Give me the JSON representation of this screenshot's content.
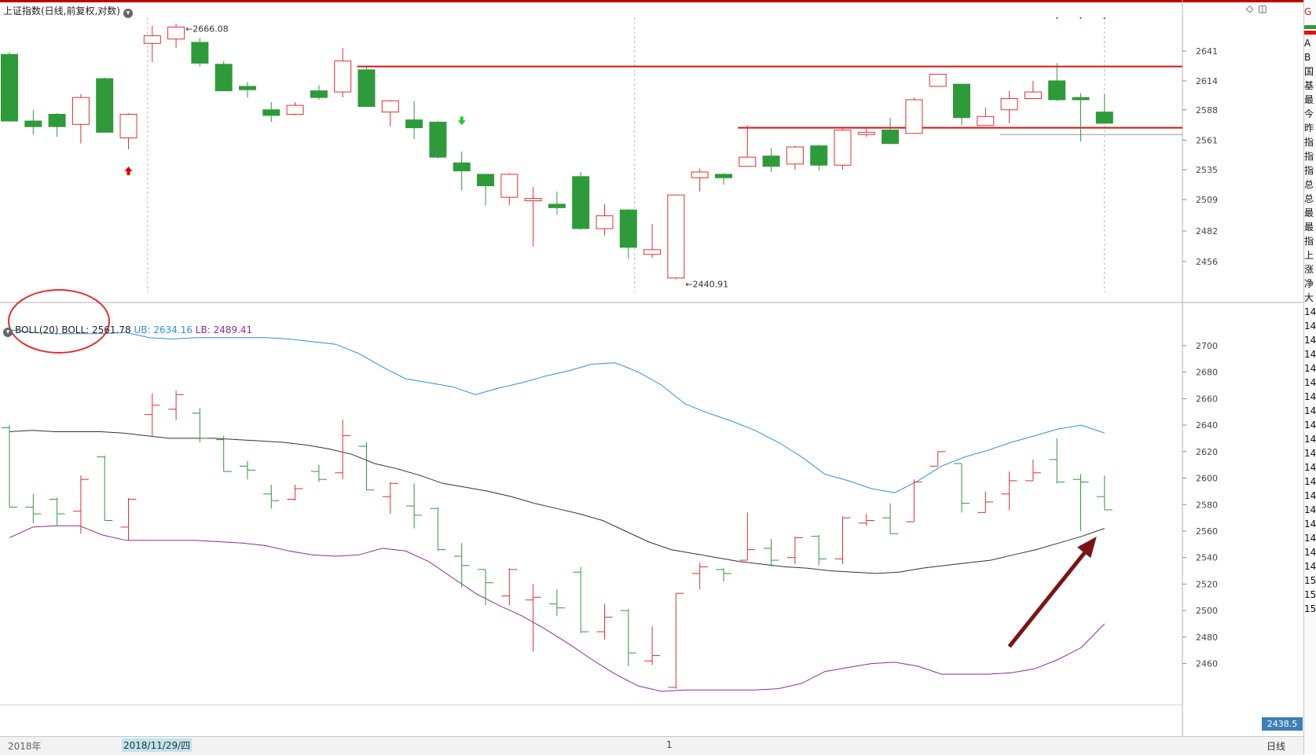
{
  "header": {
    "title": "上证指数(日线,前复权,对数)",
    "toggle_icon": "chevron-down-icon",
    "icons": [
      "diamond-icon",
      "window-icon"
    ]
  },
  "colors": {
    "up": "#e03030",
    "down": "#2f9a3a",
    "line_red": "#e01010",
    "ub": "#2f8fd8",
    "mid": "#333333",
    "lb": "#8a2d9a",
    "arrow": "#7a1515"
  },
  "right_strip": {
    "head": "G",
    "items": [
      "A",
      "B",
      "国",
      "基",
      "最",
      "今",
      "昨",
      "指",
      "指",
      "指",
      "总",
      "总",
      "最",
      "最",
      "指",
      "上",
      "涨",
      "净",
      "大",
      "14",
      "14",
      "14",
      "14",
      "14",
      "14",
      "14",
      "14",
      "14",
      "14",
      "14",
      "14",
      "14",
      "14",
      "14",
      "14",
      "14",
      "14",
      "14",
      "15",
      "15",
      "15"
    ]
  },
  "boll": {
    "toggle_icon": "chevron-down-icon",
    "name": "BOLL(20)",
    "boll_label": "BOLL: 2561.78",
    "ub_label": "UB: 2634.16",
    "lb_label": "LB: 2489.41",
    "cursor_value": "2438.5"
  },
  "bottom_bar": {
    "year": "2018年",
    "cursor_date": "2018/11/29/四",
    "marker_one": "1",
    "period": "日线"
  },
  "chart_data": [
    {
      "type": "candlestick",
      "scale": "log",
      "ylim": [
        2430,
        2672
      ],
      "yticks": [
        2456,
        2482,
        2509,
        2535,
        2561,
        2588,
        2614,
        2641
      ],
      "annotations": {
        "high_label": "2666.08",
        "low_label": "2440.91"
      },
      "hlines": [
        {
          "value": 2627,
          "from": 15,
          "to": 47
        },
        {
          "value": 2572,
          "from": 31,
          "to": 47
        },
        {
          "value": 2566,
          "from": 42,
          "to": 47,
          "color": "gray"
        }
      ],
      "signals": [
        {
          "candle": 5,
          "kind": "up",
          "price": 2553
        },
        {
          "candle": 19,
          "kind": "down",
          "price": 2566
        }
      ],
      "candles": [
        {
          "o": 2638,
          "h": 2640,
          "l": 2578,
          "c": 2578
        },
        {
          "o": 2578,
          "h": 2588,
          "l": 2566,
          "c": 2573
        },
        {
          "o": 2584,
          "h": 2585,
          "l": 2564,
          "c": 2573
        },
        {
          "o": 2575,
          "h": 2602,
          "l": 2558,
          "c": 2599
        },
        {
          "o": 2616,
          "h": 2617,
          "l": 2568,
          "c": 2568
        },
        {
          "o": 2563,
          "h": 2585,
          "l": 2553,
          "c": 2584
        },
        {
          "o": 2648,
          "h": 2664,
          "l": 2631,
          "c": 2655
        },
        {
          "o": 2652,
          "h": 2666,
          "l": 2644,
          "c": 2663
        },
        {
          "o": 2649,
          "h": 2653,
          "l": 2627,
          "c": 2630
        },
        {
          "o": 2629,
          "h": 2632,
          "l": 2605,
          "c": 2605
        },
        {
          "o": 2609,
          "h": 2613,
          "l": 2599,
          "c": 2606
        },
        {
          "o": 2588,
          "h": 2595,
          "l": 2577,
          "c": 2583
        },
        {
          "o": 2584,
          "h": 2595,
          "l": 2583,
          "c": 2592
        },
        {
          "o": 2605,
          "h": 2610,
          "l": 2597,
          "c": 2599
        },
        {
          "o": 2604,
          "h": 2644,
          "l": 2599,
          "c": 2632
        },
        {
          "o": 2624,
          "h": 2627,
          "l": 2591,
          "c": 2591
        },
        {
          "o": 2586,
          "h": 2597,
          "l": 2573,
          "c": 2596
        },
        {
          "o": 2579,
          "h": 2596,
          "l": 2562,
          "c": 2572
        },
        {
          "o": 2577,
          "h": 2578,
          "l": 2545,
          "c": 2546
        },
        {
          "o": 2541,
          "h": 2551,
          "l": 2517,
          "c": 2534
        },
        {
          "o": 2531,
          "h": 2531,
          "l": 2504,
          "c": 2521
        },
        {
          "o": 2511,
          "h": 2532,
          "l": 2504,
          "c": 2531
        },
        {
          "o": 2508,
          "h": 2520,
          "l": 2469,
          "c": 2510
        },
        {
          "o": 2505,
          "h": 2516,
          "l": 2496,
          "c": 2502
        },
        {
          "o": 2529,
          "h": 2533,
          "l": 2483,
          "c": 2484
        },
        {
          "o": 2484,
          "h": 2505,
          "l": 2478,
          "c": 2495
        },
        {
          "o": 2500,
          "h": 2501,
          "l": 2458,
          "c": 2468
        },
        {
          "o": 2462,
          "h": 2488,
          "l": 2459,
          "c": 2466
        },
        {
          "o": 2442,
          "h": 2513,
          "l": 2441,
          "c": 2513
        },
        {
          "o": 2528,
          "h": 2536,
          "l": 2516,
          "c": 2533
        },
        {
          "o": 2531,
          "h": 2532,
          "l": 2522,
          "c": 2528
        },
        {
          "o": 2538,
          "h": 2574,
          "l": 2538,
          "c": 2546
        },
        {
          "o": 2547,
          "h": 2554,
          "l": 2533,
          "c": 2538
        },
        {
          "o": 2540,
          "h": 2556,
          "l": 2535,
          "c": 2555
        },
        {
          "o": 2556,
          "h": 2557,
          "l": 2534,
          "c": 2539
        },
        {
          "o": 2539,
          "h": 2571,
          "l": 2535,
          "c": 2570
        },
        {
          "o": 2566,
          "h": 2573,
          "l": 2564,
          "c": 2568
        },
        {
          "o": 2570,
          "h": 2581,
          "l": 2558,
          "c": 2558
        },
        {
          "o": 2567,
          "h": 2599,
          "l": 2567,
          "c": 2597
        },
        {
          "o": 2609,
          "h": 2620,
          "l": 2609,
          "c": 2620
        },
        {
          "o": 2611,
          "h": 2611,
          "l": 2574,
          "c": 2581
        },
        {
          "o": 2574,
          "h": 2590,
          "l": 2574,
          "c": 2582
        },
        {
          "o": 2588,
          "h": 2605,
          "l": 2576,
          "c": 2598
        },
        {
          "o": 2598,
          "h": 2614,
          "l": 2598,
          "c": 2604
        },
        {
          "o": 2614,
          "h": 2630,
          "l": 2596,
          "c": 2597
        },
        {
          "o": 2599,
          "h": 2603,
          "l": 2560,
          "c": 2597
        },
        {
          "o": 2586,
          "h": 2602,
          "l": 2576,
          "c": 2576
        }
      ]
    },
    {
      "type": "line",
      "title": "BOLL(20)",
      "ylim": [
        2439,
        2713
      ],
      "yticks": [
        2460,
        2480,
        2500,
        2520,
        2540,
        2560,
        2580,
        2600,
        2620,
        2640,
        2660,
        2680,
        2700
      ],
      "series": [
        {
          "name": "UB",
          "values": [
            2712,
            2710,
            2709,
            2709,
            2709,
            2710,
            2706,
            2705,
            2706,
            2706,
            2706,
            2706,
            2705,
            2703,
            2701,
            2694,
            2684,
            2675,
            2672,
            2669,
            2663,
            2668,
            2672,
            2677,
            2681,
            2686,
            2687,
            2680,
            2670,
            2656,
            2649,
            2643,
            2636,
            2627,
            2616,
            2603,
            2598,
            2592,
            2589,
            2598,
            2609,
            2616,
            2621,
            2627,
            2632,
            2637,
            2640,
            2634
          ]
        },
        {
          "name": "BOLL",
          "values": [
            2635,
            2636,
            2635,
            2635,
            2635,
            2634,
            2632,
            2630,
            2630,
            2630,
            2629,
            2628,
            2627,
            2625,
            2622,
            2618,
            2611,
            2607,
            2602,
            2596,
            2593,
            2590,
            2586,
            2581,
            2577,
            2573,
            2568,
            2560,
            2552,
            2546,
            2543,
            2540,
            2537,
            2535,
            2533,
            2532,
            2530,
            2529,
            2528,
            2529,
            2532,
            2534,
            2536,
            2538,
            2542,
            2546,
            2551,
            2556,
            2562
          ]
        },
        {
          "name": "LB",
          "values": [
            2555,
            2563,
            2564,
            2564,
            2557,
            2553,
            2553,
            2553,
            2553,
            2552,
            2551,
            2549,
            2545,
            2542,
            2541,
            2542,
            2547,
            2545,
            2537,
            2525,
            2513,
            2504,
            2496,
            2486,
            2475,
            2463,
            2452,
            2443,
            2439,
            2440,
            2440,
            2440,
            2440,
            2441,
            2445,
            2454,
            2457,
            2460,
            2461,
            2458,
            2452,
            2452,
            2452,
            2453,
            2456,
            2463,
            2472,
            2490
          ]
        }
      ],
      "ohlc_ticks": true,
      "annotation": {
        "type": "arrow",
        "from_candle": 42,
        "to_candle": 46
      }
    }
  ]
}
